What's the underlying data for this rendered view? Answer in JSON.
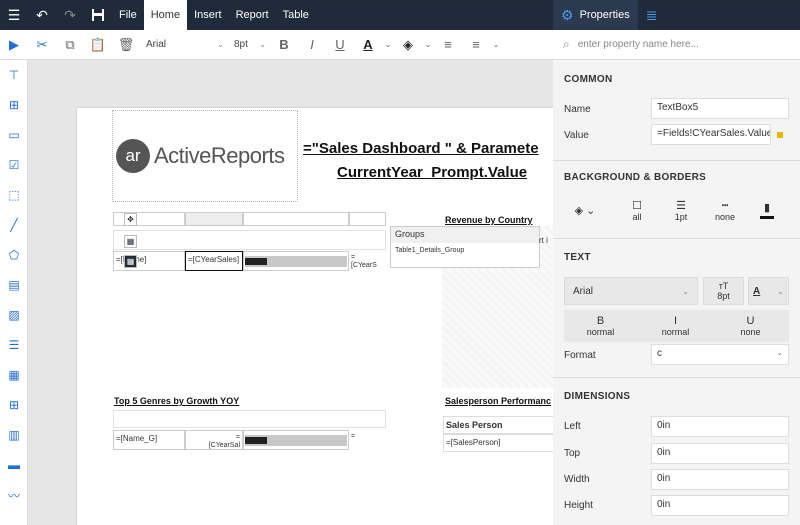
{
  "menubar": {
    "items": [
      "File",
      "Home",
      "Insert",
      "Report",
      "Table"
    ],
    "active": "Home"
  },
  "ribbon": {
    "font_family": "Arial",
    "font_size": "8pt"
  },
  "canvas": {
    "logo_text": "ActiveReports",
    "logo_badge": "ar",
    "title_line1": "=\"Sales Dashboard \" & Paramete",
    "title_line2": "CurrentYear_Prompt.Value",
    "revenue_title": "Revenue by Country",
    "top5_title": "Top 5 Genres by Growth YOY",
    "salesperson_title": "Salesperson Performanc",
    "groups_header": "Groups",
    "groups_item": "Table1_Details_Group",
    "cell_name": "=[Name]",
    "cell_cyear": "=[CYearSales]",
    "cell_eq": "=",
    "cell_cyear_trunc": "[CYearS",
    "cell_name_g": "=[Name_G]",
    "cell_cyear_g": "[CYearSal",
    "sales_person_header": "Sales Person",
    "sales_person_field": "=[SalesPerson]",
    "peek_text": "rt i"
  },
  "properties": {
    "tab_properties": "Properties",
    "search_placeholder": "enter property name here...",
    "common_header": "COMMON",
    "name_label": "Name",
    "name_value": "TextBox5",
    "value_label": "Value",
    "value_value": "=Fields!CYearSales.Value",
    "bg_header": "BACKGROUND & BORDERS",
    "border_all": "all",
    "border_width": "1pt",
    "border_style": "none",
    "text_header": "TEXT",
    "text_font": "Arial",
    "text_size": "8pt",
    "text_color_glyph": "A",
    "bold_label": "B",
    "bold_value": "normal",
    "italic_label": "I",
    "italic_value": "normal",
    "underline_label": "U",
    "underline_value": "none",
    "format_label": "Format",
    "format_value": "c",
    "dimensions_header": "DIMENSIONS",
    "left_label": "Left",
    "left_value": "0in",
    "top_label": "Top",
    "top_value": "0in",
    "width_label": "Width",
    "width_value": "0in",
    "height_label": "Height",
    "height_value": "0in"
  },
  "colors": {
    "topbar": "#1f2a3a",
    "accent": "#1e6fd9",
    "value_marker": "#f0b400"
  }
}
